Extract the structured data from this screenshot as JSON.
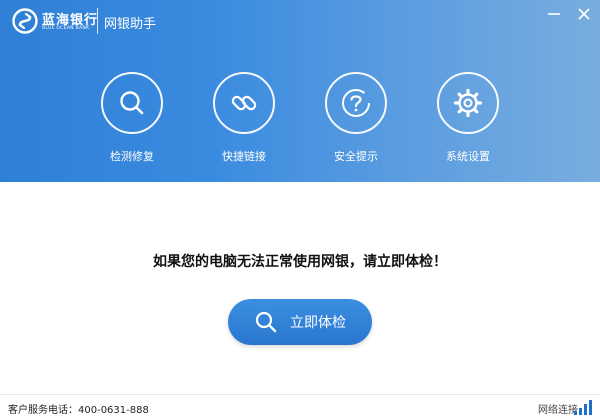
{
  "app": {
    "bank_name": "蓝海银行",
    "bank_name_en": "BLUE OCEAN BANK",
    "title": "网银助手"
  },
  "window": {
    "minimize_icon": "minimize-icon",
    "close_icon": "close-icon"
  },
  "tools": [
    {
      "label": "检测修复",
      "icon": "search-icon"
    },
    {
      "label": "快捷链接",
      "icon": "link-icon"
    },
    {
      "label": "安全提示",
      "icon": "help-icon"
    },
    {
      "label": "系统设置",
      "icon": "gear-icon"
    }
  ],
  "main": {
    "prompt": "如果您的电脑无法正常使用网银，请立即体检！",
    "check_button": "立即体检"
  },
  "footer": {
    "hotline_label": "客户服务电话：",
    "hotline_number": "400-0631-888",
    "network_status": "网络连接"
  },
  "colors": {
    "header_start": "#2f7fd6",
    "header_end": "#79addf",
    "button": "#2a76cf"
  }
}
